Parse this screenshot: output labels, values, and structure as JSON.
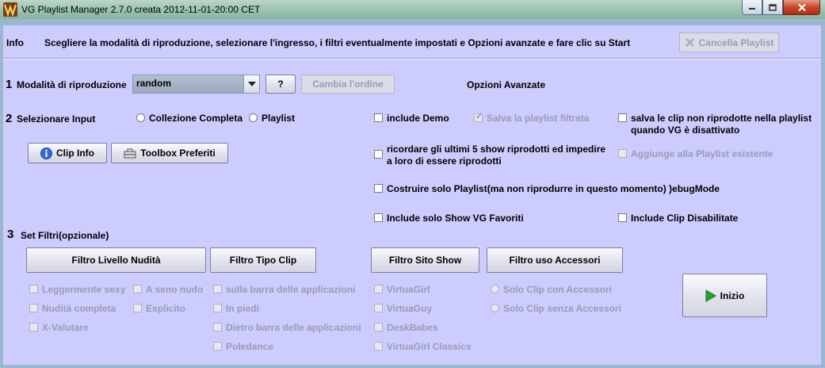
{
  "window": {
    "title": "VG Playlist Manager 2.7.0 creata 2012-11-01-20:00 CET"
  },
  "header": {
    "info_label": "Info",
    "instructions": "Scegliere la modalità di riproduzione, selezionare l'ingresso, i filtri eventualmente impostati e Opzioni avanzate e fare clic su Start",
    "clear_playlist_label": "Cancella Playlist"
  },
  "section1": {
    "number": "1",
    "label": "Modalità di riproduzione",
    "mode_value": "random",
    "help_label": "?",
    "change_order_label": "Cambia l'ordine"
  },
  "advanced": {
    "title": "Opzioni Avanzate",
    "include_demo": "include Demo",
    "save_filtered": "Salva la playlist filtrata",
    "save_unplayed": "salva le clip non riprodotte nella playlist quando VG è disattivato",
    "remember_last5": "ricordare gli ultimi 5 show riprodotti ed impedire a loro di essere riprodotti",
    "add_to_existing": "Aggiunge alla Playlist esistente",
    "build_only": "Costruire solo Playlist(ma non riprodurre in questo momento) )ebugMode",
    "only_favorites": "Include solo Show VG Favoriti",
    "include_disabled": "Include Clip Disabilitate"
  },
  "section2": {
    "number": "2",
    "label": "Selezionare Input",
    "radio_full": "Collezione Completa",
    "radio_playlist": "Playlist",
    "clip_info_label": "Clip Info",
    "toolbox_label": "Toolbox Preferiti"
  },
  "section3": {
    "number": "3",
    "label": "Set Filtri(opzionale)",
    "filter_nudity": "Filtro Livello Nudità",
    "filter_cliptype": "Filtro Tipo Clip",
    "filter_site": "Filtro Sito Show",
    "filter_accessories": "Filtro uso Accessori",
    "nudity_options": [
      "Leggermente sexy",
      "A seno nudo",
      "Nudità completa",
      "Esplicito",
      "X-Valutare"
    ],
    "cliptype_options": [
      "sulla barra delle applicazioni",
      "In piedi",
      "Dietro barra delle applicazioni",
      "Poledance"
    ],
    "site_options": [
      "VirtuaGirl",
      "VirtuaGuy",
      "DeskBabes",
      "VirtuaGirl Classics"
    ],
    "accessory_options": [
      "Solo Clip con Accessori",
      "Solo Clip senza Accessori"
    ],
    "start_label": "Inizio"
  },
  "icons": {
    "app": "vg-logo-icon",
    "clear": "x-icon",
    "dropdown": "chevron-down-icon",
    "info": "info-icon",
    "toolbox": "toolbox-icon",
    "start": "play-icon"
  },
  "colors": {
    "background": "#ccccff",
    "start_icon": "#2e9e2e",
    "info_icon": "#2f6fd0"
  }
}
